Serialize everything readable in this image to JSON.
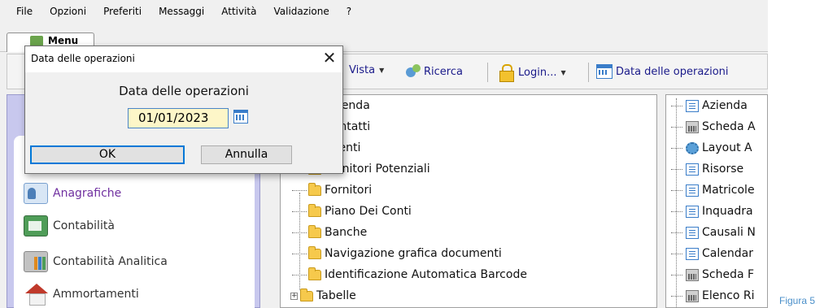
{
  "menubar": {
    "items": [
      "File",
      "Opzioni",
      "Preferiti",
      "Messaggi",
      "Attività",
      "Validazione",
      "?"
    ]
  },
  "tabstrip": {
    "active_tab": "Menu"
  },
  "toolbar": {
    "vista_label": "Vista",
    "ricerca_label": "Ricerca",
    "login_label": "Login...",
    "data_operazioni_label": "Data delle operazioni"
  },
  "leftnav": {
    "items": [
      "Anagrafiche",
      "Contabilità",
      "Contabilità Analitica",
      "Ammortamenti"
    ],
    "active": "Anagrafiche"
  },
  "midtree": {
    "items": [
      "Azienda",
      "Contatti",
      "Clienti",
      "Fornitori Potenziali",
      "Fornitori",
      "Piano Dei Conti",
      "Banche",
      "Navigazione grafica documenti",
      "Identificazione Automatica Barcode",
      "Tabelle"
    ]
  },
  "righttree": {
    "items": [
      "Azienda",
      "Scheda A",
      "Layout A",
      "Risorse",
      "Matricole",
      "Inquadra",
      "Causali N",
      "Calendar",
      "Scheda F",
      "Elenco Ri"
    ]
  },
  "dialog": {
    "title": "Data delle operazioni",
    "close_glyph": "✕",
    "label": "Data delle operazioni",
    "date_value": "01/01/2023",
    "ok_label": "OK",
    "cancel_label": "Annulla"
  },
  "caption": "Figura 5",
  "colors": {
    "accent_blue": "#0078d7",
    "nav_panel": "#c8c8ee",
    "active_nav": "#7030a0",
    "date_field_bg": "#fdf6c8",
    "caption": "#4a8fc9"
  }
}
